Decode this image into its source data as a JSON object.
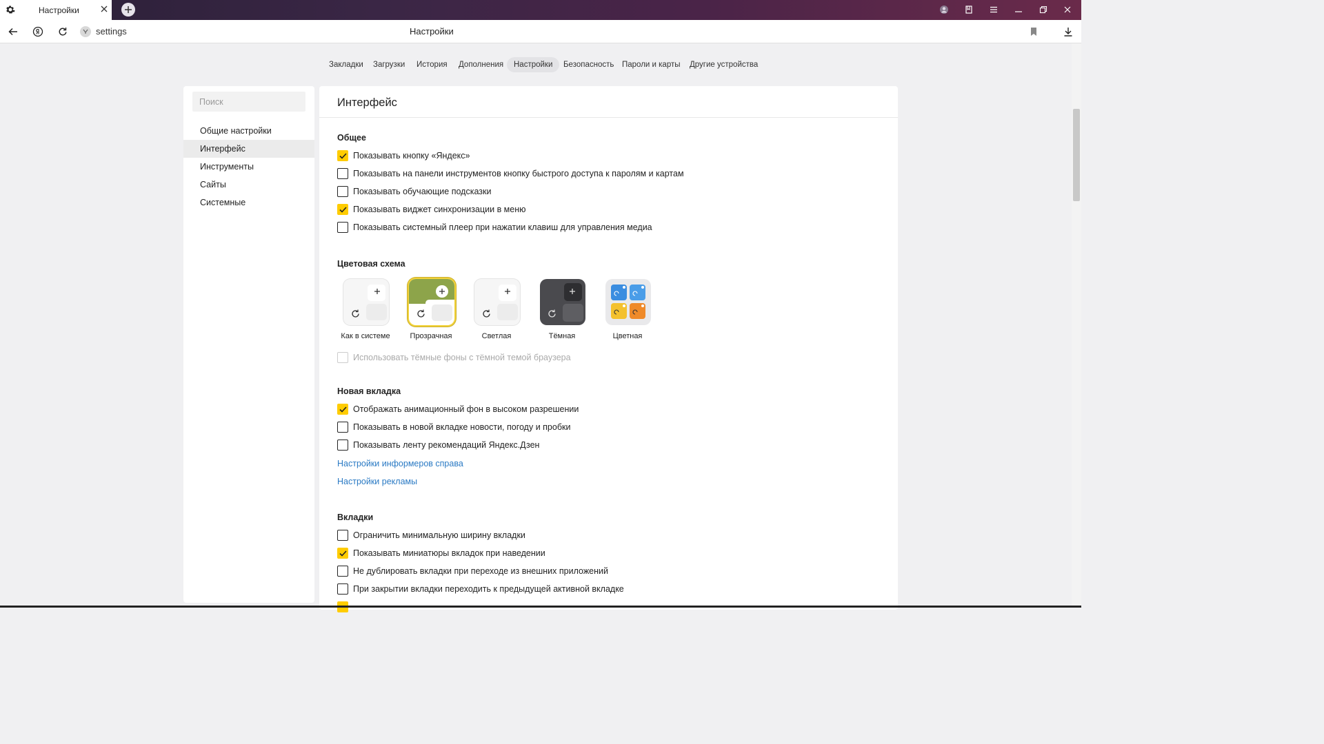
{
  "tab": {
    "title": "Настройки"
  },
  "address": {
    "url": "settings",
    "page_title": "Настройки"
  },
  "top_nav": [
    {
      "label": "Закладки"
    },
    {
      "label": "Загрузки"
    },
    {
      "label": "История"
    },
    {
      "label": "Дополнения"
    },
    {
      "label": "Настройки"
    },
    {
      "label": "Безопасность"
    },
    {
      "label": "Пароли и карты"
    },
    {
      "label": "Другие устройства"
    }
  ],
  "sidebar": {
    "search_placeholder": "Поиск",
    "items": [
      {
        "label": "Общие настройки"
      },
      {
        "label": "Интерфейс"
      },
      {
        "label": "Инструменты"
      },
      {
        "label": "Сайты"
      },
      {
        "label": "Системные"
      }
    ]
  },
  "main": {
    "title": "Интерфейс",
    "general": {
      "heading": "Общее",
      "options": [
        {
          "label": "Показывать кнопку «Яндекс»",
          "checked": true
        },
        {
          "label": "Показывать на панели инструментов кнопку быстрого доступа к паролям и картам",
          "checked": false
        },
        {
          "label": "Показывать обучающие подсказки",
          "checked": false
        },
        {
          "label": "Показывать виджет синхронизации в меню",
          "checked": true
        },
        {
          "label": "Показывать системный плеер при нажатии клавиш для управления медиа",
          "checked": false
        }
      ]
    },
    "color_scheme": {
      "heading": "Цветовая схема",
      "themes": [
        {
          "name": "Как в системе"
        },
        {
          "name": "Прозрачная",
          "selected": true
        },
        {
          "name": "Светлая"
        },
        {
          "name": "Тёмная"
        },
        {
          "name": "Цветная"
        }
      ],
      "dark_bg_option": {
        "label": "Использовать тёмные фоны с тёмной темой браузера",
        "checked": false,
        "disabled": true
      }
    },
    "new_tab": {
      "heading": "Новая вкладка",
      "options": [
        {
          "label": "Отображать анимационный фон в высоком разрешении",
          "checked": true
        },
        {
          "label": "Показывать в новой вкладке новости, погоду и пробки",
          "checked": false
        },
        {
          "label": "Показывать ленту рекомендаций Яндекс.Дзен",
          "checked": false
        }
      ],
      "link_informers": "Настройки информеров справа",
      "link_ads": "Настройки рекламы"
    },
    "tabs": {
      "heading": "Вкладки",
      "options": [
        {
          "label": "Ограничить минимальную ширину вкладки",
          "checked": false
        },
        {
          "label": "Показывать миниатюры вкладок при наведении",
          "checked": true
        },
        {
          "label": "Не дублировать вкладки при переходе из внешних приложений",
          "checked": false
        },
        {
          "label": "При закрытии вкладки переходить к предыдущей активной вкладке",
          "checked": false
        }
      ]
    }
  },
  "colors": {
    "accent": "#ffcc00",
    "link": "#2a7ac4"
  }
}
